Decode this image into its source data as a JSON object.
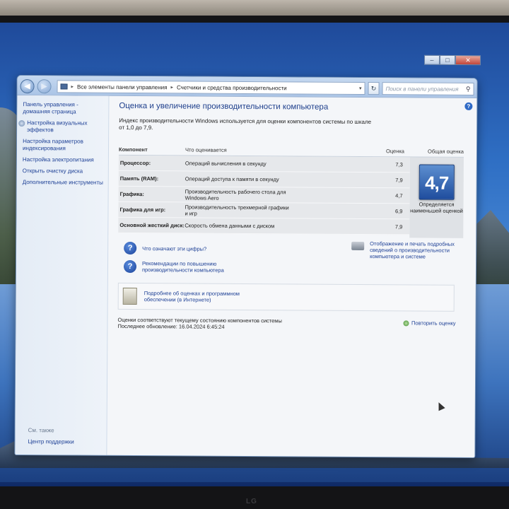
{
  "address_bar": {
    "crumbs": [
      "Все элементы панели управления",
      "Счетчики и средства производительности"
    ]
  },
  "search": {
    "placeholder": "Поиск в панели управления"
  },
  "sidebar": {
    "items": [
      {
        "label": "Панель управления - домашняя страница",
        "icon": ""
      },
      {
        "label": "Настройка визуальных эффектов",
        "icon": "shield-icon"
      },
      {
        "label": "Настройка параметров индексирования",
        "icon": ""
      },
      {
        "label": "Настройка электропитания",
        "icon": ""
      },
      {
        "label": "Открыть очистку диска",
        "icon": ""
      },
      {
        "label": "Дополнительные инструменты",
        "icon": ""
      }
    ],
    "see_also": "См. также",
    "support": "Центр поддержки"
  },
  "main": {
    "title": "Оценка и увеличение производительности компьютера",
    "intro": "Индекс производительности Windows используется для оценки компонентов системы по шкале от 1,0 до 7,9.",
    "table": {
      "headers": [
        "Компонент",
        "Что оценивается",
        "Оценка",
        "Общая оценка"
      ],
      "rows": [
        {
          "component": "Процессор:",
          "what": "Операций вычисления в секунду",
          "score": "7,3"
        },
        {
          "component": "Память (RAM):",
          "what": "Операций доступа к памяти в секунду",
          "score": "7,9"
        },
        {
          "component": "Графика:",
          "what": "Производительность рабочего стола для Windows Aero",
          "score": "4,7"
        },
        {
          "component": "Графика для игр:",
          "what": "Производительность трехмерной графики и игр",
          "score": "6,9"
        },
        {
          "component": "Основной жесткий диск:",
          "what": "Скорость обмена данными с диском",
          "score": "7,9"
        }
      ],
      "overall_score": "4,7",
      "overall_caption": "Определяется наименьшей оценкой"
    },
    "links": {
      "what_numbers": "Что означают эти цифры?",
      "recommendations": "Рекомендации по повышению производительности компьютера",
      "print": "Отображение и печать подробных сведений о производительности компьютера и системе",
      "online": "Подробнее об оценках и программном обеспечении (в Интернете)"
    },
    "status_line1": "Оценки соответствуют текущему состоянию компонентов системы",
    "status_line2": "Последнее обновление: 16.04.2024 6:45:24",
    "rerun": "Повторить оценку"
  },
  "taskbar": {
    "apps": [
      "media-player",
      "internet-explorer",
      "access",
      "excel",
      "word",
      "control-panel"
    ],
    "labels": {
      "excel": "X",
      "word": "W"
    }
  },
  "monitor_brand": "LG",
  "colors": {
    "link": "#1c3f95",
    "title": "#1e3f8c",
    "badge": "#2b5bb0"
  }
}
